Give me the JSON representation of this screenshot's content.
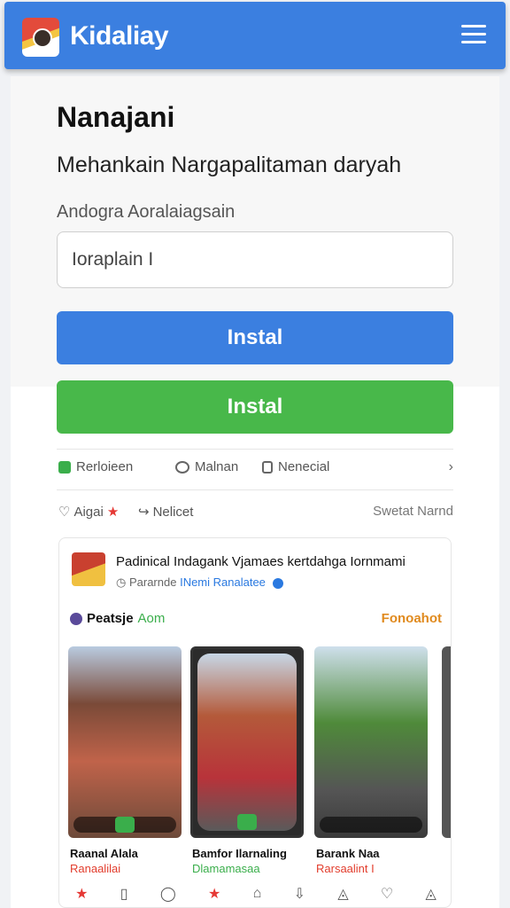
{
  "header": {
    "brand": "Kidaliay"
  },
  "form": {
    "title": "Nanajani",
    "subtitle": "Mehankain Nargapalitaman daryah",
    "field_label": "Andogra Aoralaiagsain",
    "input_value": "Ioraplain I",
    "primary_button": "Instal",
    "secondary_button": "Instal"
  },
  "tabs": [
    {
      "label": "Rerloieen",
      "icon": "bookmark-icon"
    },
    {
      "label": "Malnan",
      "icon": "chat-icon"
    },
    {
      "label": "Nenecial",
      "icon": "record-icon"
    }
  ],
  "actions": {
    "like": "Aigai",
    "share": "Nelicet",
    "more": "Swetat Narnd"
  },
  "post": {
    "title": "Padinical Indagank Vjamaes kertdahga Iornmami",
    "meta_prefix": "Pararnde",
    "meta_link": "INemi Ranalatee",
    "section_left": "Peatsje",
    "section_left_suffix": "Aom",
    "section_right": "Fonoahot",
    "captions": [
      {
        "name": "Raanal Alala",
        "sub": "Ranaalilai",
        "color": "#e23d2d"
      },
      {
        "name": "Bamfor Ilarnaling",
        "sub": "Dlamamasaa",
        "color": "#3aae4b"
      },
      {
        "name": "Barank Naa",
        "sub": "Rarsaalint I",
        "color": "#e23d2d"
      }
    ]
  },
  "colors": {
    "primary": "#3b7fe0",
    "success": "#48b84a",
    "accent": "#e08a1e"
  }
}
